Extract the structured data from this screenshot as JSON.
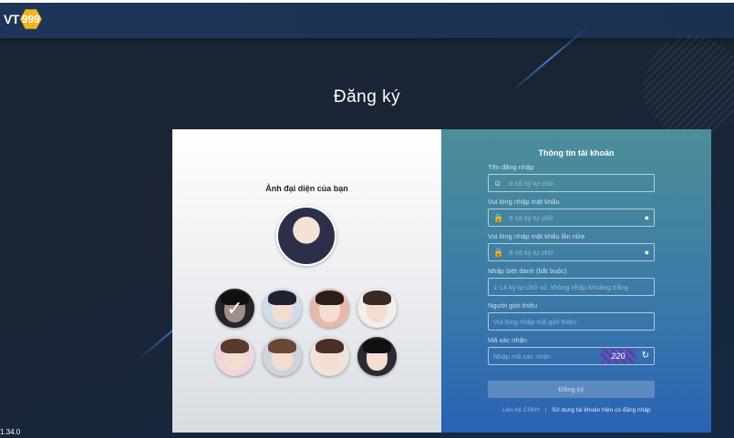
{
  "logo": {
    "prefix": "VT",
    "badge": "999"
  },
  "page": {
    "title": "Đăng ký"
  },
  "avatar_section": {
    "title": "Ảnh đại diện của bạn",
    "options": [
      {
        "name": "male-avatar-1",
        "bg": "#3c3a44",
        "hair": "#1a1a1a",
        "selected": true
      },
      {
        "name": "male-avatar-2",
        "bg": "#cfdbe8",
        "hair": "#1e2230",
        "selected": false
      },
      {
        "name": "male-avatar-3",
        "bg": "#e6b9a8",
        "hair": "#2a1d1a",
        "selected": false
      },
      {
        "name": "male-avatar-4",
        "bg": "#f2efe8",
        "hair": "#3a2a22",
        "selected": false
      },
      {
        "name": "female-avatar-1",
        "bg": "#f0d6dc",
        "hair": "#5a3a2c",
        "selected": false
      },
      {
        "name": "female-avatar-2",
        "bg": "#cfd4dc",
        "hair": "#6a4634",
        "selected": false
      },
      {
        "name": "female-avatar-3",
        "bg": "#efe3da",
        "hair": "#4a2f28",
        "selected": false
      },
      {
        "name": "female-avatar-4",
        "bg": "#2c2a30",
        "hair": "#101010",
        "selected": false
      }
    ]
  },
  "form": {
    "title": "Thông tin tài khoản",
    "username": {
      "label": "Tên đăng nhập",
      "placeholder": "6-16 ký tự chữ"
    },
    "password": {
      "label": "Vui lòng nhập mật khẩu",
      "placeholder": "8-16 ký tự chữ"
    },
    "password_confirm": {
      "label": "Vui lòng nhập mật khẩu lần nữa",
      "placeholder": "8-16 ký tự chữ"
    },
    "nickname": {
      "label": "Nhập biệt danh (bắt buộc)",
      "placeholder": "1-14 ký tự chữ số, không nhập khoảng trắng"
    },
    "referrer": {
      "label": "Người giới thiệu",
      "placeholder": "Vui lòng nhập mã giới thiệu"
    },
    "captcha": {
      "label": "Mã xác nhận",
      "placeholder": "Nhập mã xác nhận",
      "code": "220"
    },
    "submit_label": "Đăng ký",
    "footer": {
      "link1": "Liên hệ CSKH",
      "separator": "|",
      "link2": "Sử dụng tài khoản hiện có đăng nhập"
    }
  },
  "version": "1.34.0",
  "colors": {
    "badge": "#f3b21e",
    "panel_top": "#4c8e98",
    "panel_bottom": "#2a62b3"
  }
}
